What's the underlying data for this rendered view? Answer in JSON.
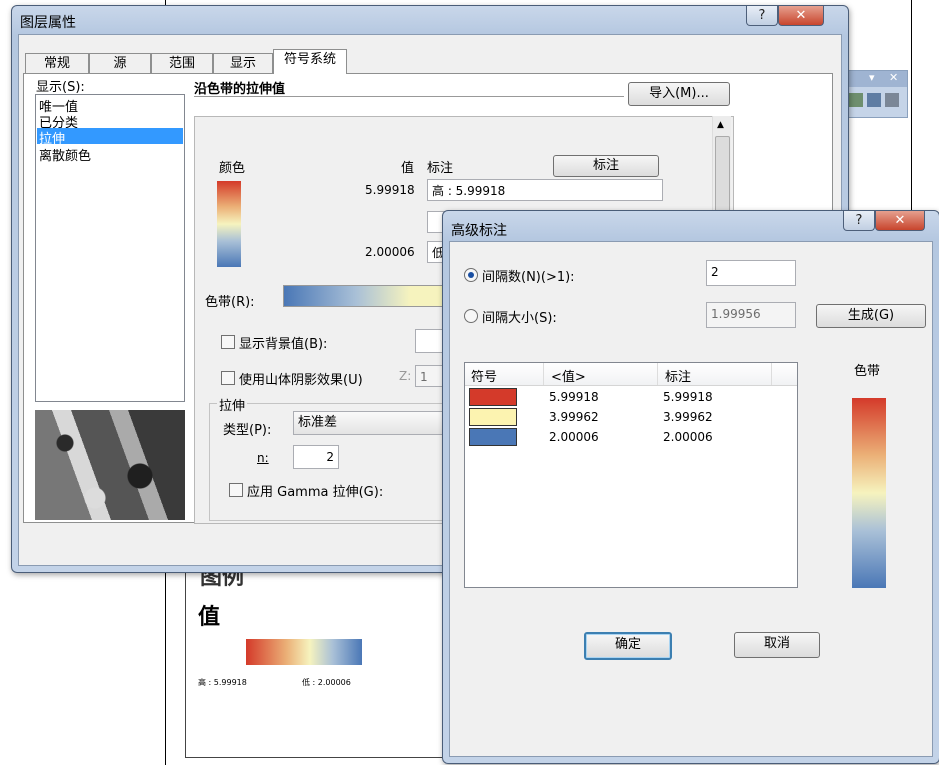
{
  "layer_props": {
    "title": "图层属性",
    "tabs": [
      "常规",
      "源",
      "范围",
      "显示",
      "符号系统"
    ],
    "show_label": "显示(S):",
    "render_types": [
      "唯一值",
      "已分类",
      "拉伸",
      "离散颜色"
    ],
    "selected_render": "拉伸",
    "heading": "沿色带的拉伸值",
    "import_btn": "导入(M)...",
    "col_color": "颜色",
    "col_value": "值",
    "col_label": "标注",
    "label_btn": "标注",
    "high_value": "5.99918",
    "high_label": "高 : 5.99918",
    "low_value": "2.00006",
    "low_label": "低",
    "color_ramp_label": "色带(R):",
    "show_bg": "显示背景值(B):",
    "hillshade": "使用山体阴影效果(U)",
    "z_label": "Z:",
    "z_value": "1",
    "stretch_group": "拉伸",
    "type_label": "类型(P):",
    "type_value": "标准差",
    "n_label": "n:",
    "n_value": "2",
    "gamma": "应用 Gamma 拉伸(G):"
  },
  "toolbar": {
    "min": "▾",
    "close": "✕"
  },
  "legend_doc": {
    "title_partial": "图例",
    "value_heading": "值",
    "high": "高 : 5.99918",
    "low": "低 : 2.00006"
  },
  "adv_label": {
    "title": "高级标注",
    "help": "?",
    "close": "✕",
    "interval_count_label": "间隔数(N)(>1):",
    "interval_count": "2",
    "interval_size_label": "间隔大小(S):",
    "interval_size": "1.99956",
    "generate_btn": "生成(G)",
    "table_headers": [
      "符号",
      "<值>",
      "标注"
    ],
    "rows": [
      {
        "color": "#d43a2a",
        "value": "5.99918",
        "label": "5.99918"
      },
      {
        "color": "#fcf3b0",
        "value": "3.99962",
        "label": "3.99962"
      },
      {
        "color": "#4a77b6",
        "value": "2.00006",
        "label": "2.00006"
      }
    ],
    "ramp_label": "色带",
    "ok_btn": "确定",
    "cancel_btn": "取消"
  },
  "colors": {
    "selection": "#3399ff",
    "title_blue": "#b4c7e0"
  }
}
